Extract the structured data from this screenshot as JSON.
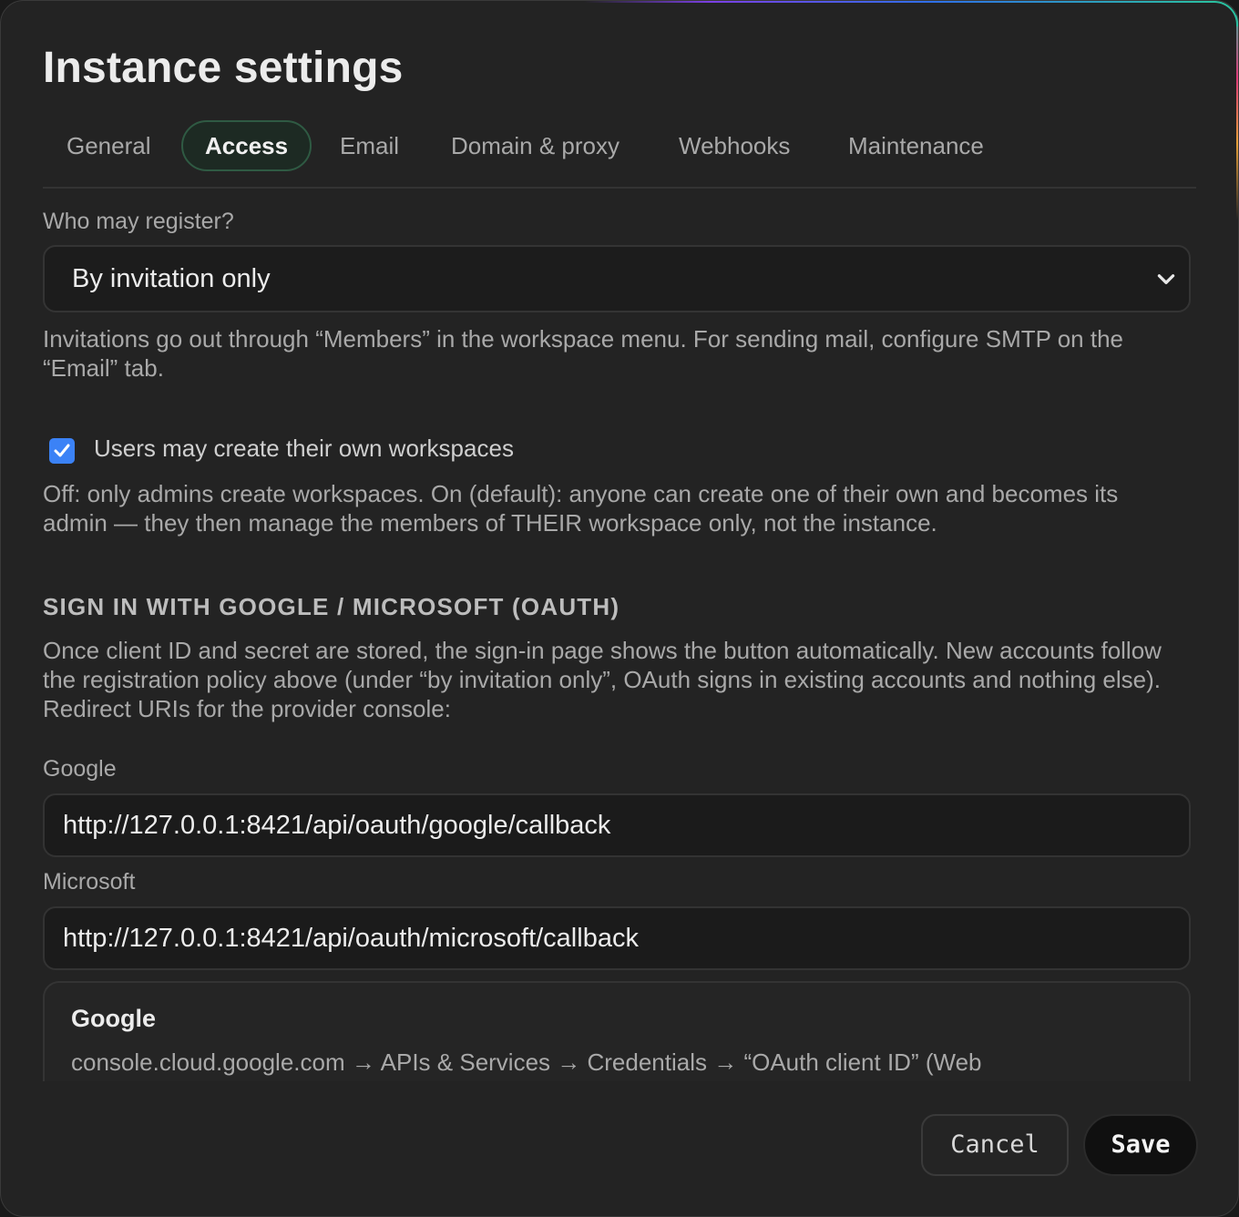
{
  "dialog": {
    "title": "Instance settings",
    "tabs": [
      {
        "label": "General",
        "active": false
      },
      {
        "label": "Access",
        "active": true
      },
      {
        "label": "Email",
        "active": false
      },
      {
        "label": "Domain & proxy",
        "active": false
      },
      {
        "label": "Webhooks",
        "active": false
      },
      {
        "label": "Maintenance",
        "active": false
      }
    ]
  },
  "registration": {
    "label": "Who may register?",
    "selected": "By invitation only",
    "help": "Invitations go out through “Members” in the workspace menu. For sending mail, configure SMTP on the “Email” tab."
  },
  "workspaces": {
    "checkbox_label": "Users may create their own workspaces",
    "checked": true,
    "help": "Off: only admins create workspaces. On (default): anyone can create one of their own and becomes its admin — they then manage the members of THEIR workspace only, not the instance."
  },
  "oauth": {
    "section_title": "SIGN IN WITH GOOGLE / MICROSOFT (OAUTH)",
    "help": "Once client ID and secret are stored, the sign-in page shows the button automatically. New accounts follow the registration policy above (under “by invitation only”, OAuth signs in existing accounts and nothing else). Redirect URIs for the provider console:",
    "google_label": "Google",
    "google_uri": "http://127.0.0.1:8421/api/oauth/google/callback",
    "microsoft_label": "Microsoft",
    "microsoft_uri": "http://127.0.0.1:8421/api/oauth/microsoft/callback",
    "card": {
      "title": "Google",
      "text": "console.cloud.google.com → APIs & Services → Credentials → “OAuth client ID” (Web"
    }
  },
  "footer": {
    "cancel_label": "Cancel",
    "save_label": "Save"
  },
  "colors": {
    "accent_checkbox": "#3b82f6",
    "active_tab_border": "#2f5a43"
  }
}
